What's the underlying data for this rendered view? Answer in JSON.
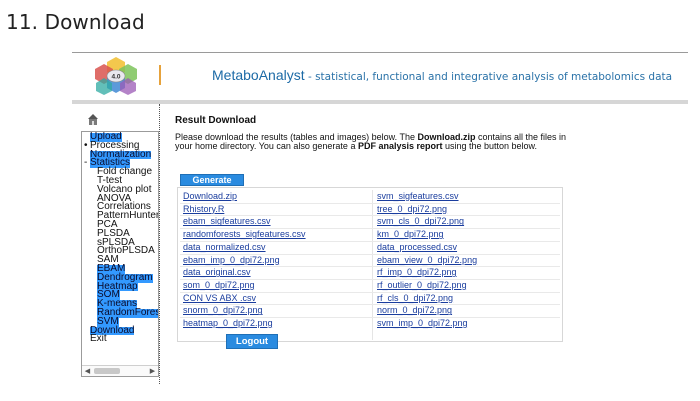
{
  "doc_heading": "11. Download",
  "app": {
    "name": "MetaboAnalyst",
    "tagline": " - statistical, functional and integrative analysis of metabolomics data",
    "logo_text": "4.0"
  },
  "sidebar": {
    "items": [
      {
        "label": "Upload",
        "highlighted": true
      },
      {
        "label": "Processing",
        "highlighted": false
      },
      {
        "label": "Normalization",
        "highlighted": true
      },
      {
        "label": "Statistics",
        "highlighted": true
      },
      {
        "label": "Fold change",
        "highlighted": false
      },
      {
        "label": "T-test",
        "highlighted": false
      },
      {
        "label": "Volcano plot",
        "highlighted": false
      },
      {
        "label": "ANOVA",
        "highlighted": false
      },
      {
        "label": "Correlations",
        "highlighted": false
      },
      {
        "label": "PatternHunter",
        "highlighted": false
      },
      {
        "label": "PCA",
        "highlighted": false
      },
      {
        "label": "PLSDA",
        "highlighted": false
      },
      {
        "label": "sPLSDA",
        "highlighted": false
      },
      {
        "label": "OrthoPLSDA",
        "highlighted": false
      },
      {
        "label": "SAM",
        "highlighted": false
      },
      {
        "label": "EBAM",
        "highlighted": true
      },
      {
        "label": "Dendrogram",
        "highlighted": true
      },
      {
        "label": "Heatmap",
        "highlighted": true
      },
      {
        "label": "SOM",
        "highlighted": true
      },
      {
        "label": "K-means",
        "highlighted": true
      },
      {
        "label": "RandomForest",
        "highlighted": true
      },
      {
        "label": "SVM",
        "highlighted": true
      },
      {
        "label": "Download",
        "highlighted": true
      },
      {
        "label": "Exit",
        "highlighted": false
      }
    ]
  },
  "main": {
    "title": "Result Download",
    "desc_1": "Please download the results (tables and images) below. The ",
    "desc_zip": "Download.zip",
    "desc_2": " contains all the files in your home directory. You can also generate a ",
    "desc_report": "PDF analysis report",
    "desc_3": " using the button below.",
    "generate_label": "Generate",
    "logout_label": "Logout",
    "files": [
      [
        "Download.zip",
        "svm_sigfeatures.csv"
      ],
      [
        "Rhistory.R",
        "tree_0_dpi72.png"
      ],
      [
        "ebam_sigfeatures.csv",
        "svm_cls_0_dpi72.png"
      ],
      [
        "randomforests_sigfeatures.csv",
        "km_0_dpi72.png"
      ],
      [
        "data_normalized.csv",
        "data_processed.csv"
      ],
      [
        "ebam_imp_0_dpi72.png",
        "ebam_view_0_dpi72.png"
      ],
      [
        "data_original.csv",
        "rf_imp_0_dpi72.png"
      ],
      [
        "som_0_dpi72.png",
        "rf_outlier_0_dpi72.png"
      ],
      [
        "CON VS ABX .csv",
        "rf_cls_0_dpi72.png"
      ],
      [
        "snorm_0_dpi72.png",
        "norm_0_dpi72.png"
      ],
      [
        "heatmap_0_dpi72.png",
        "svm_imp_0_dpi72.png"
      ]
    ]
  },
  "colors": {
    "accent": "#2a8be0",
    "title_blue": "#1c6aa6",
    "link": "#1a3d9e",
    "highlight": "#3399ff"
  }
}
